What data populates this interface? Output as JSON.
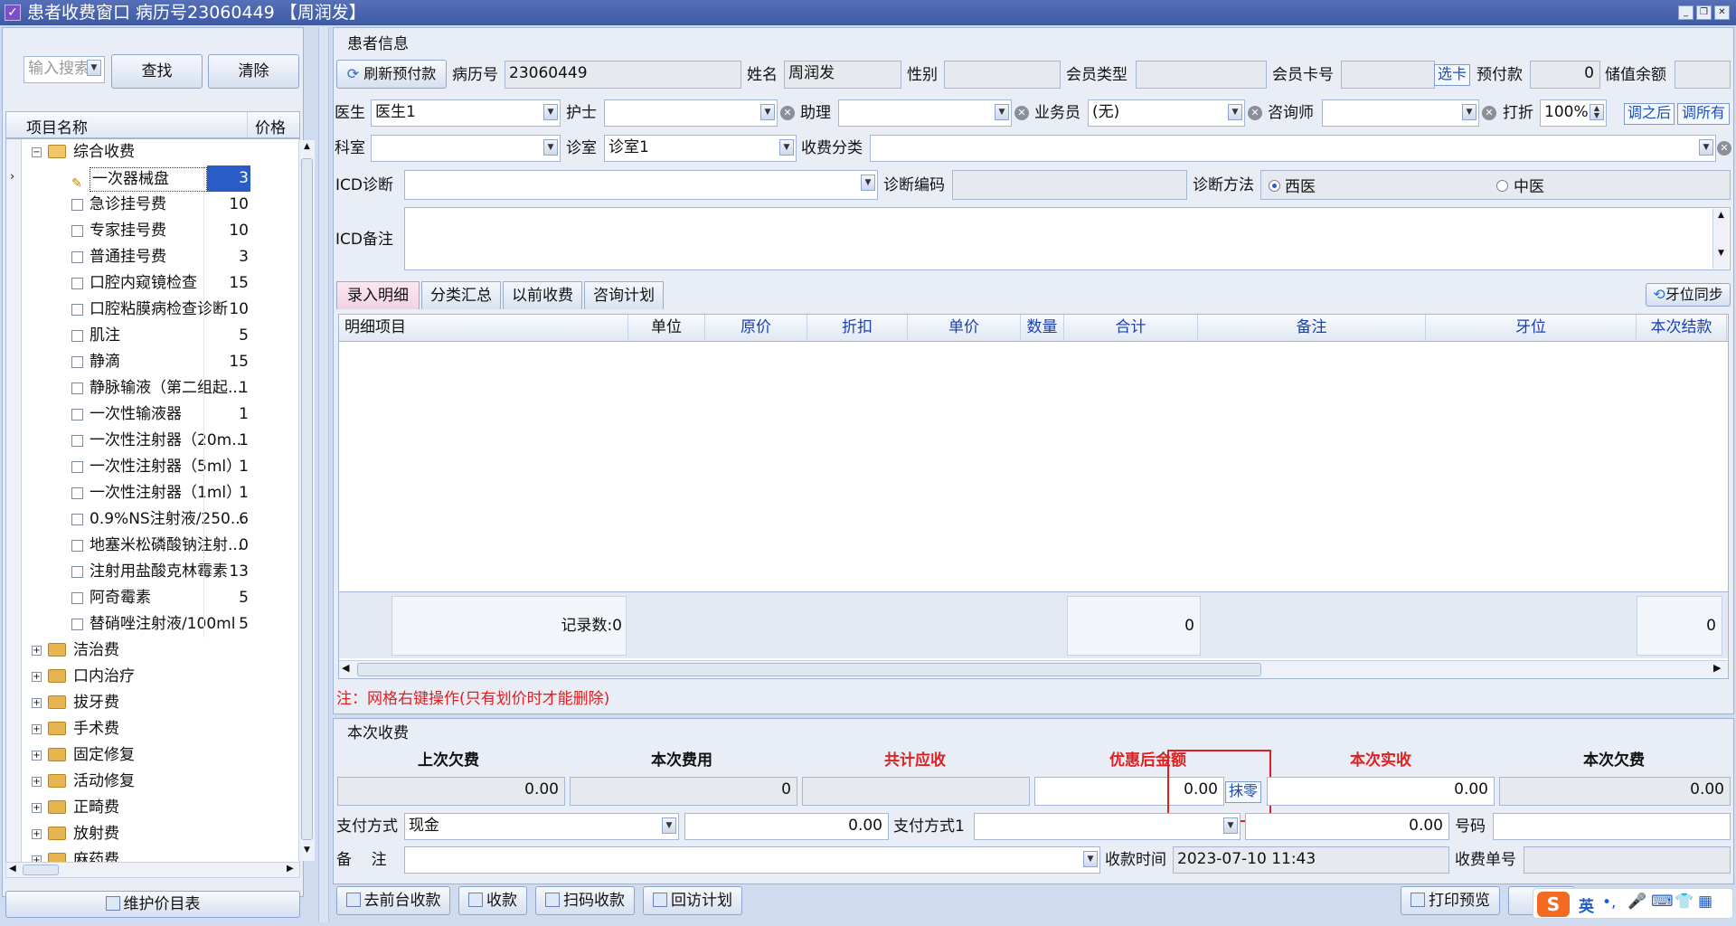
{
  "window": {
    "title": "患者收费窗口  病历号23060449 【周润发】",
    "controls": [
      "minimize",
      "restore",
      "close"
    ]
  },
  "left": {
    "search_placeholder": "输入搜索",
    "find_label": "查找",
    "clear_label": "清除",
    "col_name": "项目名称",
    "col_price": "价格",
    "root_group": "综合收费",
    "items": [
      {
        "name": "一次器械盘",
        "price": "3"
      },
      {
        "name": "急诊挂号费",
        "price": "10"
      },
      {
        "name": "专家挂号费",
        "price": "10"
      },
      {
        "name": "普通挂号费",
        "price": "3"
      },
      {
        "name": "口腔内窥镜检查",
        "price": "15"
      },
      {
        "name": "口腔粘膜病检查诊断",
        "price": "10"
      },
      {
        "name": "肌注",
        "price": "5"
      },
      {
        "name": "静滴",
        "price": "15"
      },
      {
        "name": "静脉输液（第二组起...",
        "price": "1"
      },
      {
        "name": "一次性输液器",
        "price": "1"
      },
      {
        "name": "一次性注射器（20m...",
        "price": "1"
      },
      {
        "name": "一次性注射器（5ml）",
        "price": "1"
      },
      {
        "name": "一次性注射器（1ml）",
        "price": "1"
      },
      {
        "name": "0.9%NS注射液/250...",
        "price": "6"
      },
      {
        "name": "地塞米松磷酸钠注射...",
        "price": "0"
      },
      {
        "name": "注射用盐酸克林霉素",
        "price": "13"
      },
      {
        "name": "阿奇霉素",
        "price": "5"
      },
      {
        "name": "替硝唑注射液/100ml",
        "price": "5"
      }
    ],
    "groups": [
      "洁治费",
      "口内治疗",
      "拔牙费",
      "手术费",
      "固定修复",
      "活动修复",
      "正畸费",
      "放射费",
      "麻药费"
    ],
    "maintain_label": "维护价目表"
  },
  "patient": {
    "section_title": "患者信息",
    "refresh_label": "刷新预付款",
    "record_no_label": "病历号",
    "record_no": "23060449",
    "name_label": "姓名",
    "name": "周润发",
    "gender_label": "性别",
    "gender": "",
    "member_type_label": "会员类型",
    "member_type": "",
    "card_label": "会员卡号",
    "card": "",
    "choose_card": "选卡",
    "prepay_label": "预付款",
    "prepay": "0",
    "balance_label": "储值余额",
    "balance": "",
    "doctor_label": "医生",
    "doctor": "医生1",
    "nurse_label": "护士",
    "nurse": "",
    "assistant_label": "助理",
    "assistant": "",
    "sales_label": "业务员",
    "sales": "(无)",
    "consultant_label": "咨询师",
    "consultant": "",
    "discount_label": "打折",
    "discount": "100%",
    "adj_after": "调之后",
    "adj_all": "调所有",
    "dept_label": "科室",
    "dept": "",
    "room_label": "诊室",
    "room": "诊室1",
    "category_label": "收费分类",
    "category": "",
    "icd_label": "ICD诊断",
    "icd": "",
    "diag_code_label": "诊断编码",
    "diag_code": "",
    "diag_method_label": "诊断方法",
    "western": "西医",
    "chinese": "中医",
    "icd_note_label": "ICD备注",
    "icd_note": ""
  },
  "tabs": [
    "录入明细",
    "分类汇总",
    "以前收费",
    "咨询计划"
  ],
  "tooth_sync": "牙位同步",
  "grid": {
    "columns": [
      "明细项目",
      "单位",
      "原价",
      "折扣",
      "单价",
      "数量",
      "合计",
      "备注",
      "牙位",
      "本次结款"
    ],
    "record_count": "记录数:0",
    "total": "0",
    "settle_total": "0"
  },
  "note": "注：网格右键操作(只有划价时才能删除)",
  "payment": {
    "section_title": "本次收费",
    "labels": [
      "上次欠费",
      "本次费用",
      "共计应收",
      "优惠后金额",
      "本次实收",
      "本次欠费"
    ],
    "last_owed": "0.00",
    "this_fee": "0",
    "total_due": "",
    "after_discount": "0.00",
    "wipe_label": "抹零",
    "actual": "0.00",
    "owed": "0.00",
    "method_label": "支付方式",
    "method": "现金",
    "method_amount": "0.00",
    "method1_label": "支付方式1",
    "method1": "",
    "method1_amount": "0.00",
    "number_label": "号码",
    "number": "",
    "remark_label": "备    注",
    "remark": "",
    "time_label": "收款时间",
    "time": "2023-07-10 11:43",
    "receipt_label": "收费单号",
    "receipt": ""
  },
  "footer": {
    "front_desk": "去前台收款",
    "collect": "收款",
    "scan": "扫码收款",
    "followup": "回访计划",
    "print_preview": "打印预览"
  },
  "ime": {
    "lang": "英"
  },
  "colors": {
    "title": "#3d5aa6",
    "red": "#e02020",
    "blue": "#1a3fb0",
    "selected": "#2a5cc8"
  }
}
